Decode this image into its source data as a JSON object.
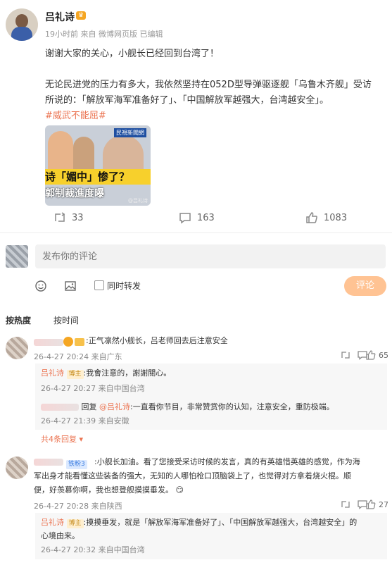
{
  "post": {
    "username": "吕礼诗",
    "meta": "19小时前 来自 微博网页版 已编辑",
    "line1": "谢谢大家的关心，小舰长已经回到台湾了！",
    "line2": "无论民进党的压力有多大，我依然坚持在052D型导弹驱逐舰「乌鲁木齐舰」受访",
    "line3": "所说的：「解放军海军准备好了」、「中国解放军越强大，台湾越安全」。",
    "hashtag": "#威武不能屈#",
    "thumb": {
      "tag": "民視新聞網",
      "caption1": "诗「媚中」惨了？",
      "caption2": "郭制裁進度曝",
      "watermark": "@吕礼诗"
    },
    "reposts": "33",
    "comments": "163",
    "likes": "1083"
  },
  "composer": {
    "placeholder": "发布你的评论",
    "forward_label": "同时转发",
    "submit_label": "评论"
  },
  "sort_tabs": {
    "hot": "按热度",
    "time": "按时间"
  },
  "comments": [
    {
      "text": ":正气凛然小舰长，吕老师回去后注意安全",
      "meta": "26-4-27 20:24 来自广东",
      "likes": "65",
      "replies": [
        {
          "name": "吕礼诗",
          "badge": "博主",
          "text": ":我會注意的，謝謝關心。",
          "meta": "26-4-27 20:27 来自中国台湾"
        },
        {
          "reply_prefix": "回复",
          "reply_to": "@吕礼诗",
          "text": ":一直看你节目，非常赞赏你的认知，注意安全，重防极端。",
          "meta": "26-4-27 21:39 来自安徽"
        }
      ],
      "expand": "共4条回复"
    },
    {
      "badge": "铁粉3",
      "text1": ":小舰长加油。看了您接受采访时候的发言，真的有英雄惜英雄的感觉，作为海",
      "text2": "军出身才能看懂这些装备的强大，无知的人哪怕枪口顶脑袋上了，也觉得对方拿着烧火棍。顺",
      "text3": "便，好羡慕你啊，我也想登舰摸摸垂发。",
      "meta": "26-4-27 20:28 来自陕西",
      "likes": "27",
      "replies": [
        {
          "name": "吕礼诗",
          "badge": "博主",
          "text1": ":摸摸垂发，就是「解放军海军准备好了」、「中国解放军越强大，台湾越安全」的",
          "text2": "心境由来。",
          "meta": "26-4-27 20:32 来自中国台湾"
        }
      ]
    }
  ]
}
